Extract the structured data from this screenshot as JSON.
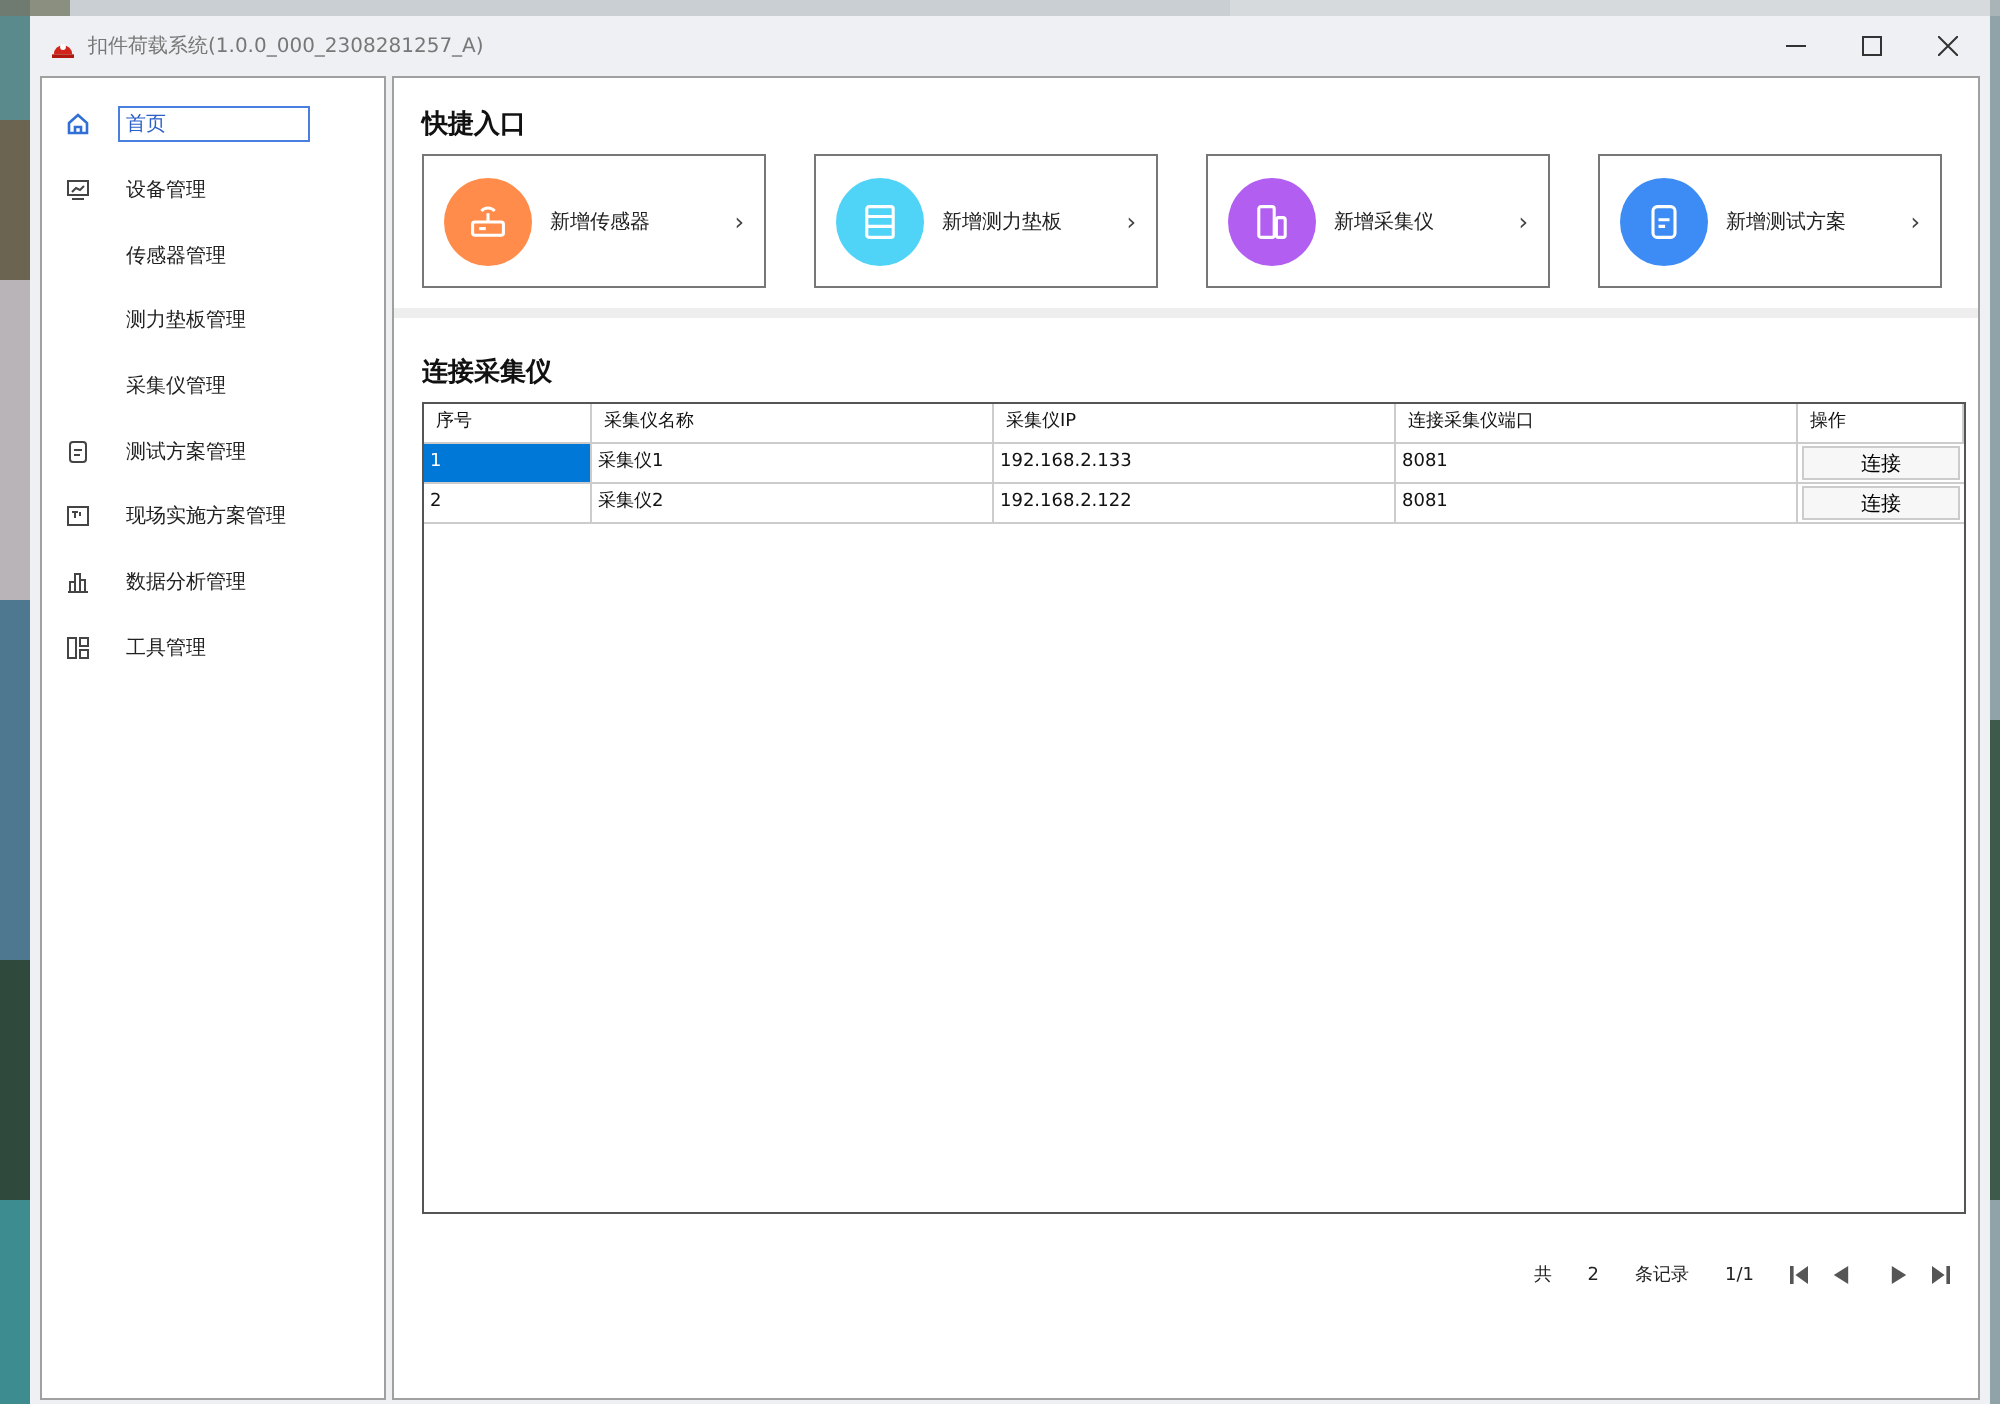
{
  "window": {
    "title": "扣件荷载系统(1.0.0_000_2308281257_A)"
  },
  "sidebar": {
    "items": [
      {
        "label": "首页",
        "selected": true
      },
      {
        "label": "设备管理",
        "selected": false,
        "children": [
          {
            "label": "传感器管理",
            "selected": false
          },
          {
            "label": "测力垫板管理",
            "selected": false
          },
          {
            "label": "采集仪管理",
            "selected": false
          }
        ]
      },
      {
        "label": "测试方案管理",
        "selected": false
      },
      {
        "label": "现场实施方案管理",
        "selected": false
      },
      {
        "label": "数据分析管理",
        "selected": false
      },
      {
        "label": "工具管理",
        "selected": false
      }
    ]
  },
  "quick_entry": {
    "title": "快捷入口",
    "cards": [
      {
        "label": "新增传感器",
        "color": "#ff8c4a",
        "arrow": "›"
      },
      {
        "label": "新增测力垫板",
        "color": "#4fd3f7",
        "arrow": "›"
      },
      {
        "label": "新增采集仪",
        "color": "#b25ef0",
        "arrow": "›"
      },
      {
        "label": "新增测试方案",
        "color": "#3d8cf5",
        "arrow": "›"
      }
    ]
  },
  "collectors": {
    "title": "连接采集仪",
    "table": {
      "columns": [
        "序号",
        "采集仪名称",
        "采集仪IP",
        "连接采集仪端口",
        "操作"
      ],
      "rows": [
        {
          "cells": [
            "1",
            "采集仪1",
            "192.168.2.133",
            "8081"
          ],
          "action": "连接",
          "selected": true
        },
        {
          "cells": [
            "2",
            "采集仪2",
            "192.168.2.122",
            "8081"
          ],
          "action": "连接",
          "selected": false
        }
      ]
    },
    "pagination": {
      "prefix": "共",
      "total": "2",
      "suffix": "条记录",
      "page": "1/1"
    }
  }
}
